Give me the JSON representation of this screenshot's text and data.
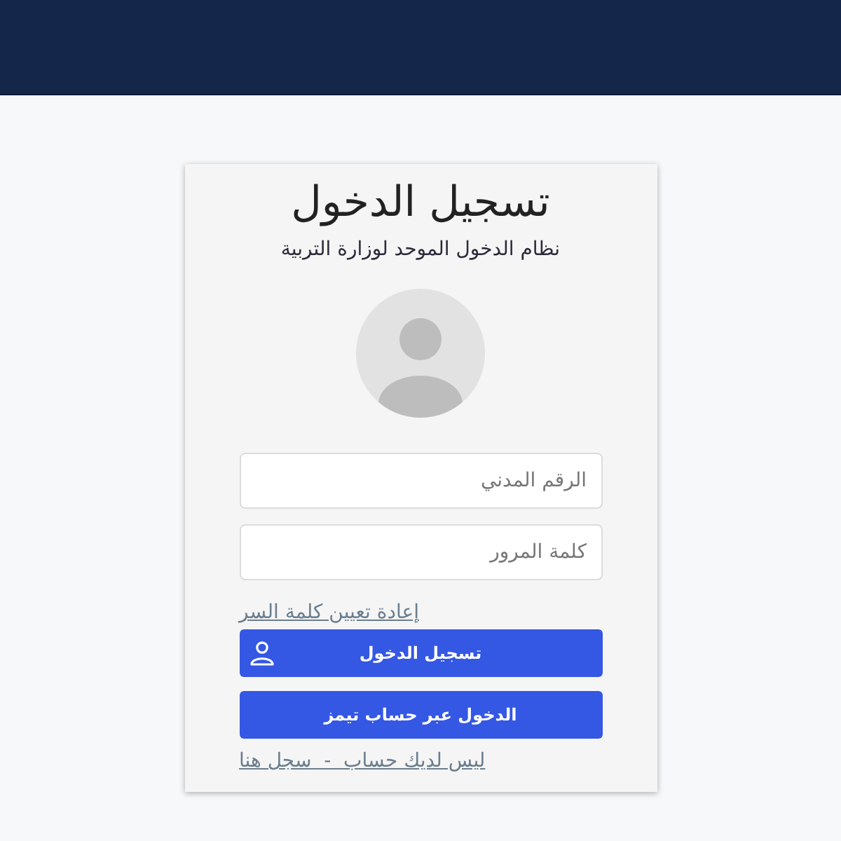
{
  "login_card": {
    "title": "تسجيل الدخول",
    "subtitle": "نظام الدخول الموحد لوزارة التربية",
    "fields": [
      {
        "placeholder": "الرقم المدني"
      },
      {
        "placeholder": "كلمة المرور"
      }
    ],
    "reset_link": "إعادة تعيين كلمة السر",
    "buttons": [
      {
        "label": "تسجيل الدخول",
        "kind": "user"
      },
      {
        "label": "الدخول عبر حساب تيمز",
        "kind": "plain"
      }
    ],
    "register_link": "ليس لديك حساب  -  سجل هنا"
  }
}
